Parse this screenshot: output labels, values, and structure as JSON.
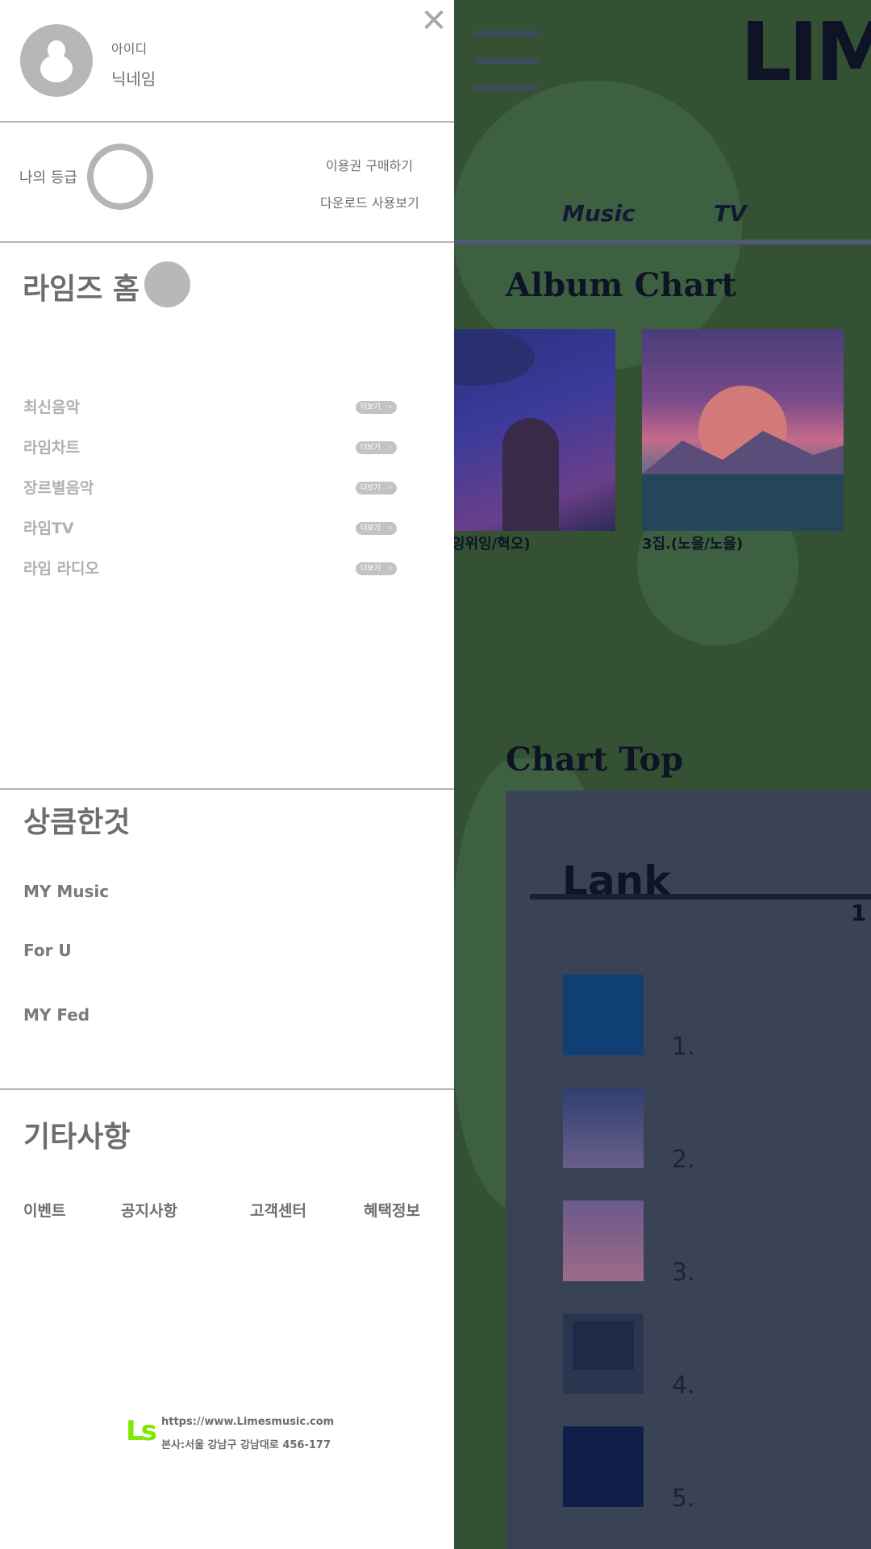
{
  "background_app": {
    "logo": "LIM",
    "nav_tabs": [
      "Music",
      "TV"
    ],
    "album_chart": {
      "title": "Album Chart",
      "albums": [
        {
          "caption": "잉위잉/혁오)"
        },
        {
          "caption": "3집.(노을/노을)"
        }
      ]
    },
    "chart_top": {
      "title": "Chart Top",
      "rank_title": "Lank",
      "column_header": "1",
      "ranks": [
        "1.",
        "2.",
        "3.",
        "4.",
        "5."
      ]
    }
  },
  "drawer": {
    "user": {
      "id": "아이디",
      "nickname": "닉네임"
    },
    "grade_label": "나의 등급",
    "ticket_link": "이용권 구매하기",
    "download_link": "다운로드 사용보기",
    "home_title": "라임즈 홈",
    "menu_items": [
      {
        "label": "최신음악",
        "more": "더보기"
      },
      {
        "label": "라임차트",
        "more": "더보기"
      },
      {
        "label": "장르별음악",
        "more": "더보기"
      },
      {
        "label": "라임TV",
        "more": "더보기"
      },
      {
        "label": "라임 라디오",
        "more": "더보기"
      }
    ],
    "personal_title": "상큼한것",
    "personal_items": [
      "MY Music",
      "For U",
      "MY Fed"
    ],
    "etc_title": "기타사항",
    "etc_links": [
      "이벤트",
      "공지사항",
      "고객센터",
      "혜택정보"
    ],
    "footer": {
      "logo": "Ls",
      "url": "https://www.Limesmusic.com",
      "address": "본사:서울 강남구 강남대로 456-177"
    }
  },
  "colors": {
    "overlay_bg": "#345233",
    "drawer_bg": "#ffffff",
    "logo_green": "#7ee800",
    "muted_text": "#6e6e6e"
  }
}
